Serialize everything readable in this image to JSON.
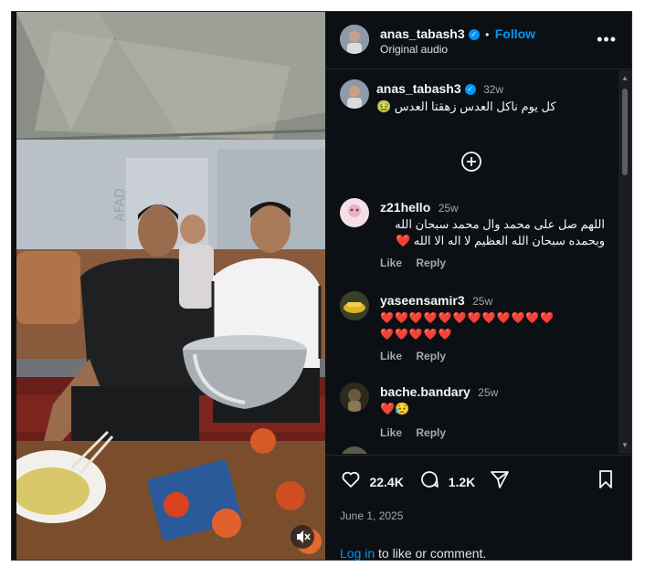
{
  "post": {
    "username": "anas_tabash3",
    "follow_label": "Follow",
    "audio_label": "Original audio",
    "more_icon": "more-horizontal-icon"
  },
  "caption": {
    "username": "anas_tabash3",
    "age": "32w",
    "text": "كل يوم ناكل العدس زهقتا العدس 🤢"
  },
  "comments": [
    {
      "username": "z21hello",
      "age": "25w",
      "line1": "اللهم صل على محمد وال محمد سبحان الله",
      "line2": "وبحمده سبحان الله العظيم لا اله الا الله ❤️",
      "like": "Like",
      "reply": "Reply"
    },
    {
      "username": "yaseensamir3",
      "age": "25w",
      "line1": "❤️❤️❤️❤️❤️❤️❤️❤️❤️❤️❤️❤️",
      "line2": "❤️❤️❤️❤️❤️",
      "like": "Like",
      "reply": "Reply"
    },
    {
      "username": "bache.bandary",
      "age": "25w",
      "line1": "❤️😥",
      "like": "Like",
      "reply": "Reply"
    }
  ],
  "stats": {
    "likes": "22.4K",
    "comments": "1.2K",
    "date": "June 1, 2025"
  },
  "login": {
    "link": "Log in",
    "rest": " to like or comment."
  }
}
